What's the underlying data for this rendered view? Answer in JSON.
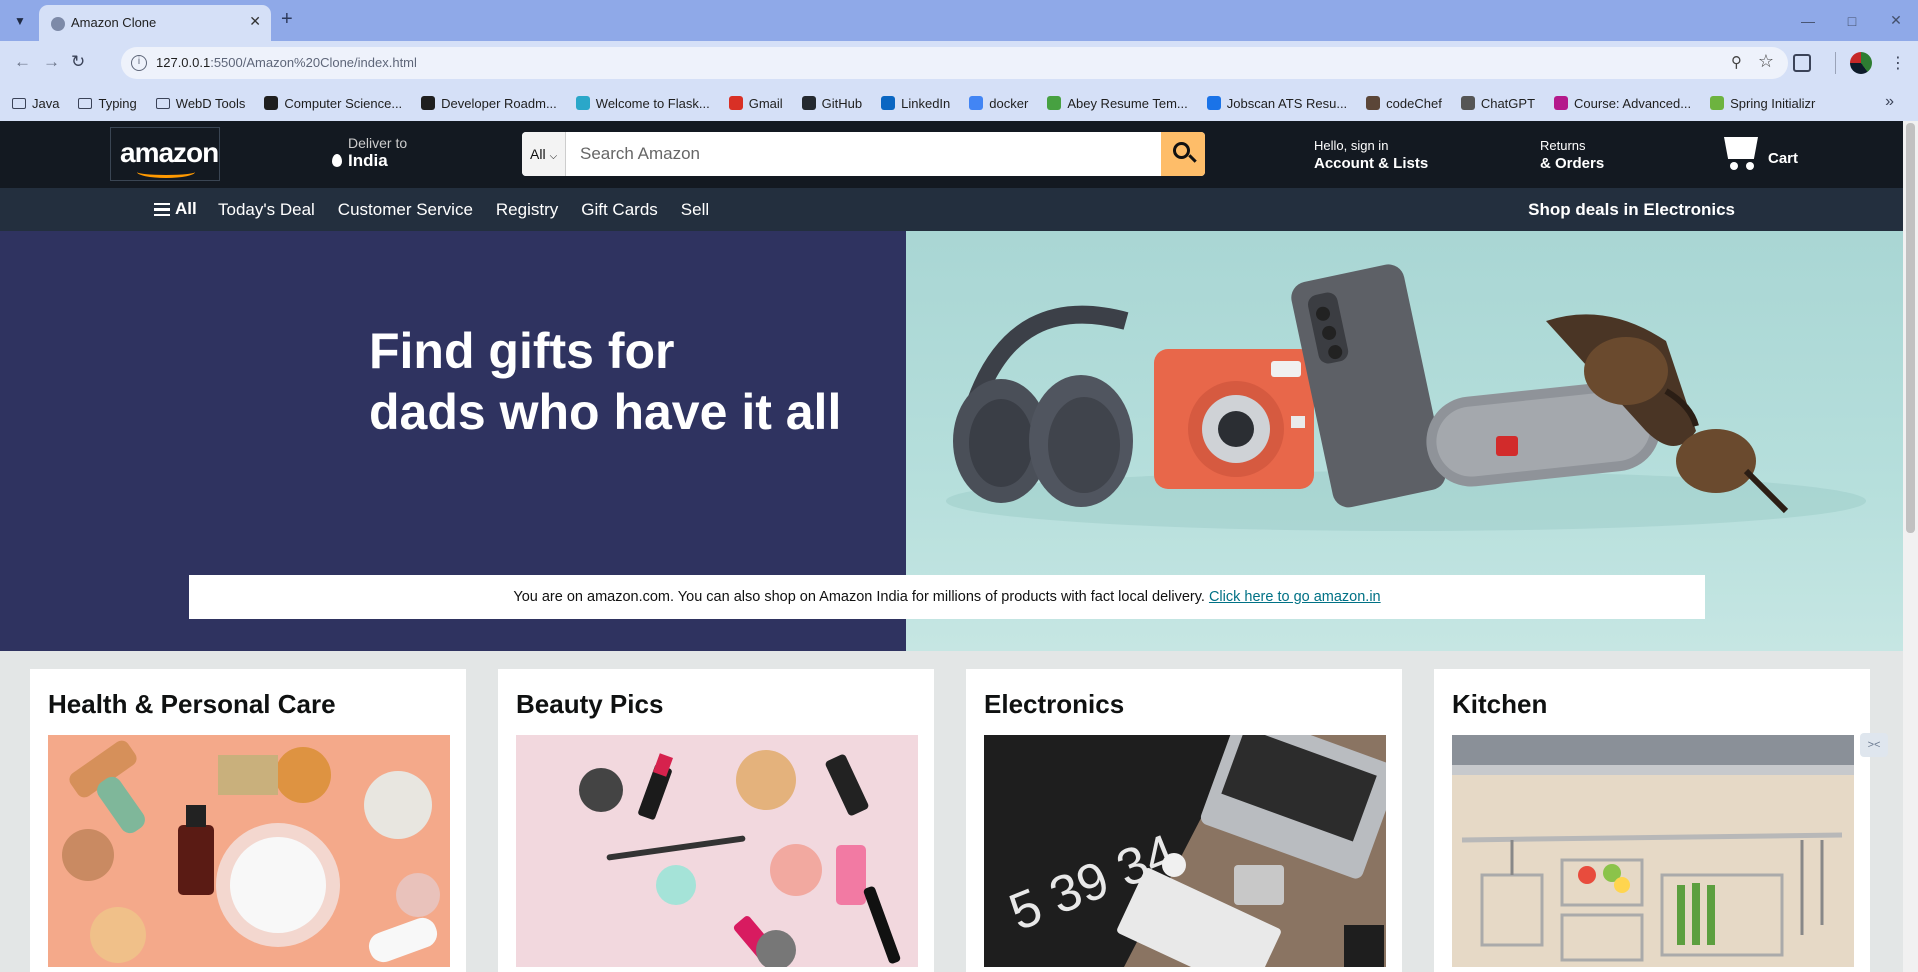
{
  "browser": {
    "tab_title": "Amazon Clone",
    "url_host": "127.0.0.1",
    "url_rest": ":5500/Amazon%20Clone/index.html",
    "bookmarks": [
      {
        "label": "Java",
        "icon": "folder-icon",
        "color": ""
      },
      {
        "label": "Typing",
        "icon": "folder-icon",
        "color": ""
      },
      {
        "label": "WebD Tools",
        "icon": "folder-icon",
        "color": ""
      },
      {
        "label": "Computer Science...",
        "icon": "geeks-icon",
        "color": "#1f1f1f"
      },
      {
        "label": "Developer Roadm...",
        "icon": "roadmap-icon",
        "color": "#1f1f1f"
      },
      {
        "label": "Welcome to Flask...",
        "icon": "flask-icon",
        "color": "#2aa7c9"
      },
      {
        "label": "Gmail",
        "icon": "gmail-icon",
        "color": "#d93025"
      },
      {
        "label": "GitHub",
        "icon": "github-icon",
        "color": "#24292f"
      },
      {
        "label": "LinkedIn",
        "icon": "linkedin-icon",
        "color": "#0a66c2"
      },
      {
        "label": "docker",
        "icon": "google-icon",
        "color": "#4285f4"
      },
      {
        "label": "Abey Resume Tem...",
        "icon": "overleaf-icon",
        "color": "#47a141"
      },
      {
        "label": "Jobscan ATS Resu...",
        "icon": "jobscan-icon",
        "color": "#1a73e8"
      },
      {
        "label": "codeChef",
        "icon": "codechef-icon",
        "color": "#5b4638"
      },
      {
        "label": "ChatGPT",
        "icon": "chatgpt-icon",
        "color": "#555"
      },
      {
        "label": "Course: Advanced...",
        "icon": "course-icon",
        "color": "#b4198b"
      },
      {
        "label": "Spring Initializr",
        "icon": "spring-icon",
        "color": "#6db33f"
      }
    ]
  },
  "header": {
    "logo_text": "amazon",
    "deliver_line1": "Deliver to",
    "deliver_line2": "India",
    "search_category": "All",
    "search_placeholder": "Search Amazon",
    "account_line1": "Hello, sign in",
    "account_line2": "Account & Lists",
    "returns_line1": "Returns",
    "returns_line2": "& Orders",
    "cart_label": "Cart"
  },
  "subnav": {
    "all_label": "All",
    "links": [
      "Today's Deal",
      "Customer Service",
      "Registry",
      "Gift Cards",
      "Sell"
    ],
    "deals_label": "Shop deals in Electronics"
  },
  "hero": {
    "title_line1": "Find gifts for",
    "title_line2": "dads who have it all"
  },
  "notice": {
    "text": "You are on amazon.com. You can also shop on Amazon India for millions of products with fact local delivery.",
    "link_text": "Click here to go amazon.in"
  },
  "cards": [
    {
      "title": "Health & Personal Care"
    },
    {
      "title": "Beauty Pics"
    },
    {
      "title": "Electronics"
    },
    {
      "title": "Kitchen"
    }
  ],
  "colors": {
    "nav_dark": "#131921",
    "nav_sub": "#232f3e",
    "accent": "#febd69",
    "link": "#007185",
    "hero_left": "#2f3360"
  }
}
